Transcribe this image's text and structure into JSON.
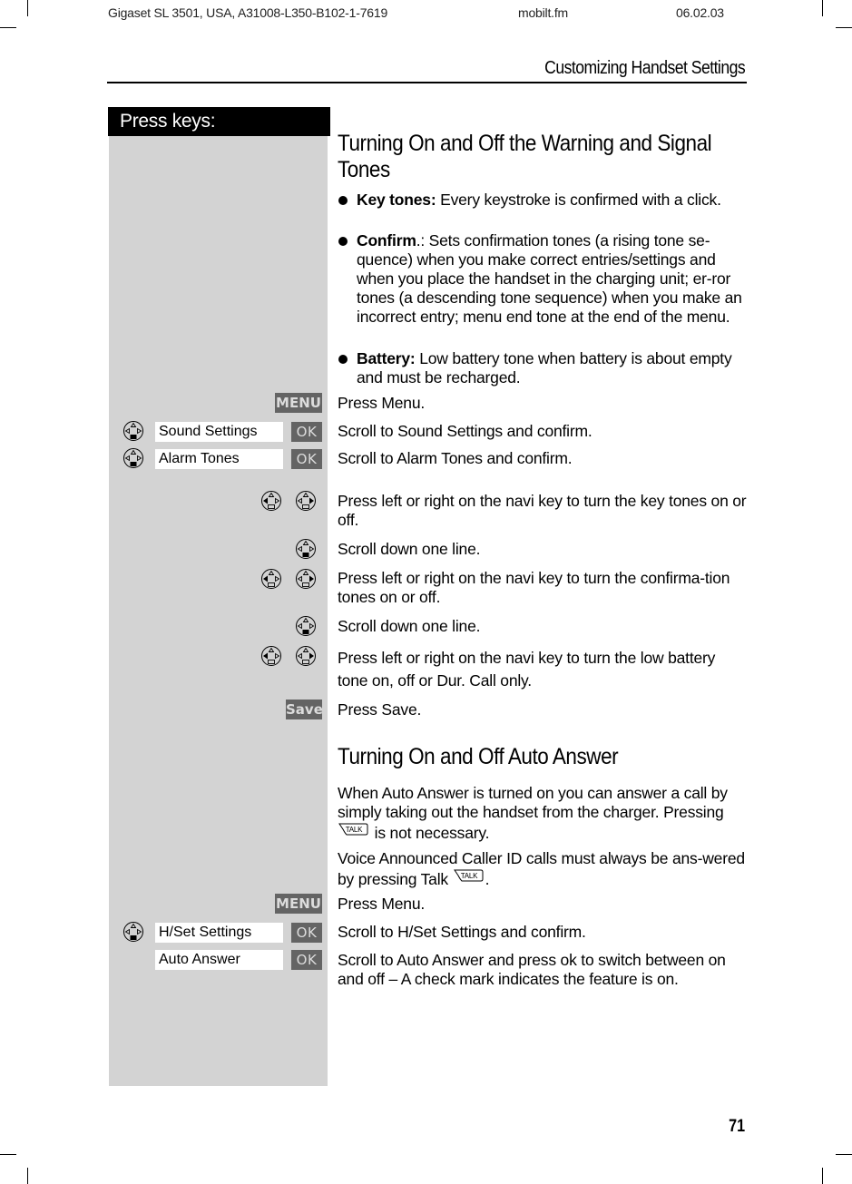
{
  "header": {
    "doc_id": "Gigaset SL 3501, USA, A31008-L350-B102-1-7619",
    "file": "mobilt.fm",
    "date": "06.02.03",
    "running_title": "Customizing Handset Settings"
  },
  "keys_column": {
    "heading": "Press keys:"
  },
  "section1": {
    "title": "Turning On and Off the Warning and Signal Tones",
    "bullets": [
      {
        "term": "Key tones:",
        "text": " Every keystroke is confirmed with a click."
      },
      {
        "term": "Confirm",
        "text": ".: Sets confirmation tones (a rising tone se-quence) when you make correct entries/settings and when you place the handset in the charging unit; er-ror tones (a descending tone sequence) when you make an incorrect entry; menu end tone at the end of the menu."
      },
      {
        "term": "Battery:",
        "text": " Low battery tone when battery is about empty and must be recharged."
      }
    ],
    "steps": [
      {
        "keys": {
          "softkey": "MENU"
        },
        "text": "Press Menu."
      },
      {
        "keys": {
          "navi": "navi-down-icon",
          "display": "Sound Settings",
          "softkey": "OK"
        },
        "text": "Scroll to Sound Settings and confirm."
      },
      {
        "keys": {
          "navi": "navi-down-icon",
          "display": "Alarm Tones",
          "softkey": "OK"
        },
        "text": "Scroll to Alarm Tones and confirm."
      },
      {
        "keys": {
          "navi": [
            "navi-left-icon",
            "navi-right-icon"
          ]
        },
        "text": "Press left or right on the navi key to turn the key tones on or off."
      },
      {
        "keys": {
          "navi": "navi-down-icon"
        },
        "text": "Scroll down one line."
      },
      {
        "keys": {
          "navi": [
            "navi-left-icon",
            "navi-right-icon"
          ]
        },
        "text": "Press left or right on the navi key to turn the confirma-tion tones on or off."
      },
      {
        "keys": {
          "navi": "navi-down-icon"
        },
        "text": "Scroll down one line."
      },
      {
        "keys": {
          "navi": [
            "navi-left-icon",
            "navi-right-icon"
          ]
        },
        "text": "Press left or right on the navi key to turn the low battery tone on, off or Dur. Call only."
      },
      {
        "keys": {
          "softkey": "Save"
        },
        "text": "Press Save."
      }
    ]
  },
  "section2": {
    "title": "Turning On and Off Auto Answer",
    "para1_a": "When Auto Answer is turned on you can answer a call by simply taking out the handset from the charger. Pressing ",
    "para1_b": " is not necessary.",
    "para2_a": "Voice Announced Caller ID calls must always be ans-wered by pressing Talk ",
    "para2_b": ".",
    "talk_key_label": "TALK",
    "steps": [
      {
        "keys": {
          "softkey": "MENU"
        },
        "text": "Press Menu."
      },
      {
        "keys": {
          "navi": "navi-down-icon",
          "display": "H/Set Settings",
          "softkey": "OK"
        },
        "text": "Scroll to H/Set Settings and confirm."
      },
      {
        "keys": {
          "display": "Auto Answer",
          "softkey": "OK"
        },
        "text": "Scroll to Auto Answer and press ok to switch between on and off – A check mark indicates the feature is on."
      }
    ]
  },
  "footer": {
    "page_number": "71"
  }
}
